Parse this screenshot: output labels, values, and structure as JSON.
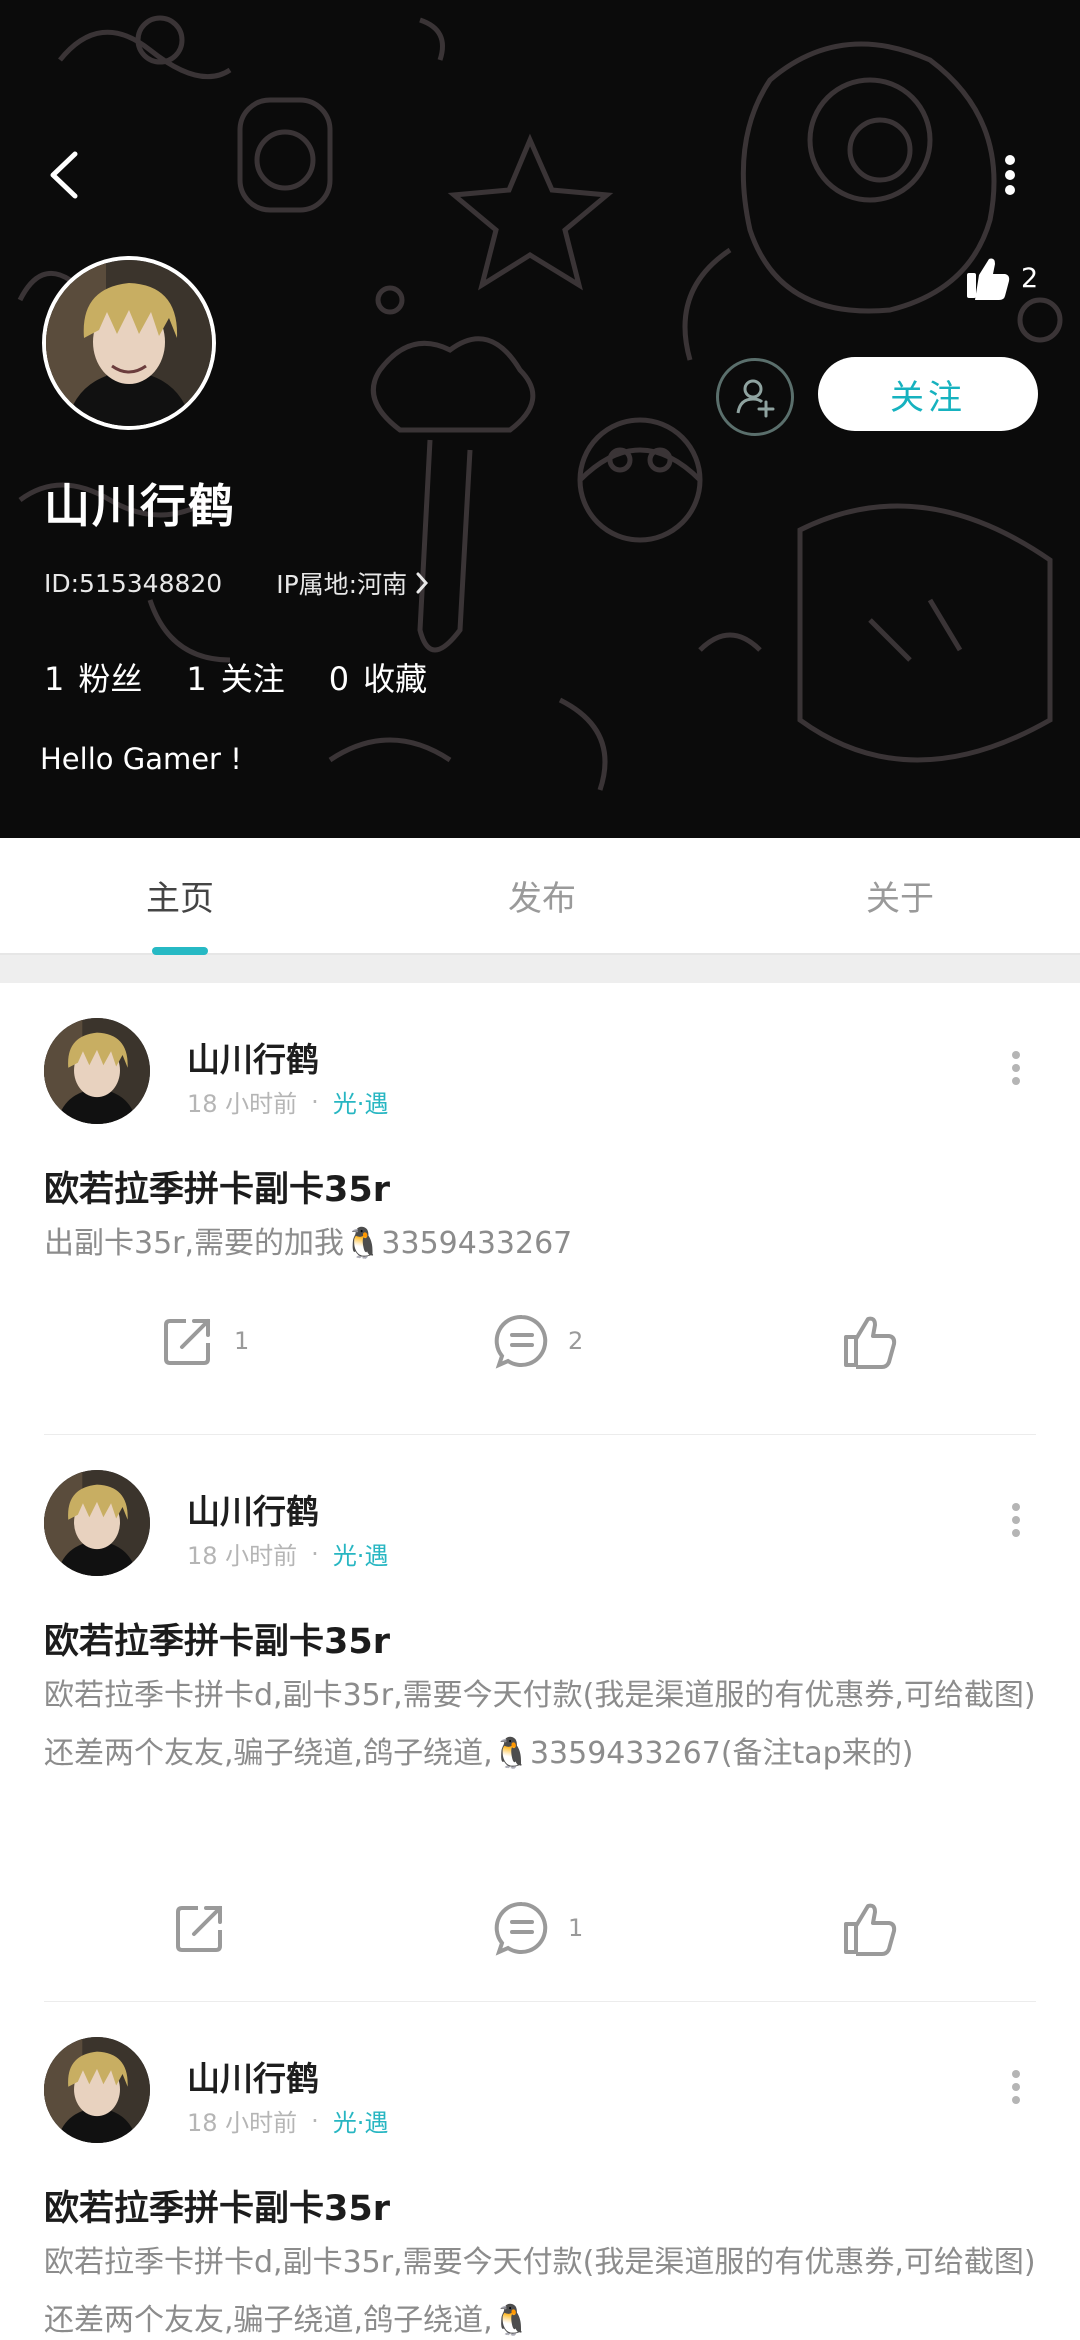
{
  "header": {
    "like_count": "2",
    "username": "山川行鹤",
    "user_id": "ID:515348820",
    "ip_location": "IP属地:河南",
    "follow_label": "关注",
    "stats": [
      {
        "num": "1",
        "label": "粉丝"
      },
      {
        "num": "1",
        "label": "关注"
      },
      {
        "num": "0",
        "label": "收藏"
      }
    ],
    "bio": "Hello Gamer !"
  },
  "tabs": [
    {
      "label": "主页",
      "active": true
    },
    {
      "label": "发布",
      "active": false
    },
    {
      "label": "关于",
      "active": false
    }
  ],
  "colors": {
    "accent": "#26b9c4",
    "header_bg": "#0b0b0b"
  },
  "posts": [
    {
      "author": "山川行鹤",
      "time": "18 小时前",
      "group": "光·遇",
      "title": "欧若拉季拼卡副卡35r",
      "body": "出副卡35r,需要的加我🐧3359433267",
      "share_count": "1",
      "comment_count": "2",
      "like_count": ""
    },
    {
      "author": "山川行鹤",
      "time": "18 小时前",
      "group": "光·遇",
      "title": "欧若拉季拼卡副卡35r",
      "body": "欧若拉季卡拼卡d,副卡35r,需要今天付款(我是渠道服的有优惠券,可给截图)还差两个友友,骗子绕道,鸽子绕道,🐧3359433267(备注tap来的)",
      "share_count": "",
      "comment_count": "1",
      "like_count": ""
    },
    {
      "author": "山川行鹤",
      "time": "18 小时前",
      "group": "光·遇",
      "title": "欧若拉季拼卡副卡35r",
      "body": "欧若拉季卡拼卡d,副卡35r,需要今天付款(我是渠道服的有优惠券,可给截图)还差两个友友,骗子绕道,鸽子绕道,🐧"
    }
  ]
}
